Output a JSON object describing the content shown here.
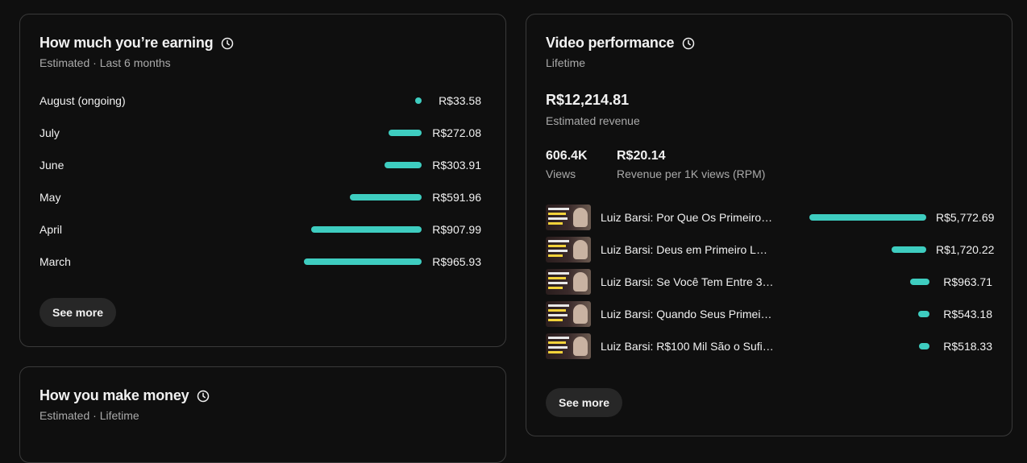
{
  "earning": {
    "title": "How much you’re earning",
    "subtitle": "Estimated · Last 6 months",
    "see_more": "See more",
    "months": [
      {
        "label": "August (ongoing)",
        "value": "R$33.58",
        "amount": 33.58
      },
      {
        "label": "July",
        "value": "R$272.08",
        "amount": 272.08
      },
      {
        "label": "June",
        "value": "R$303.91",
        "amount": 303.91
      },
      {
        "label": "May",
        "value": "R$591.96",
        "amount": 591.96
      },
      {
        "label": "April",
        "value": "R$907.99",
        "amount": 907.99
      },
      {
        "label": "March",
        "value": "R$965.93",
        "amount": 965.93
      }
    ]
  },
  "make_money": {
    "title": "How you make money",
    "subtitle": "Estimated · Lifetime"
  },
  "video_performance": {
    "title": "Video performance",
    "subtitle": "Lifetime",
    "revenue_value": "R$12,214.81",
    "revenue_label": "Estimated revenue",
    "views_value": "606.4K",
    "views_label": "Views",
    "rpm_value": "R$20.14",
    "rpm_label": "Revenue per 1K views (RPM)",
    "see_more": "See more",
    "videos": [
      {
        "title": "Luiz Barsi: Por Que Os Primeiros 1...",
        "value": "R$5,772.69",
        "amount": 5772.69
      },
      {
        "title": "Luiz Barsi: Deus em Primeiro Lugar...",
        "value": "R$1,720.22",
        "amount": 1720.22
      },
      {
        "title": "Luiz Barsi: Se Você Tem Entre 35 e...",
        "value": "R$963.71",
        "amount": 963.71
      },
      {
        "title": "Luiz Barsi: Quando Seus Primeiros ...",
        "value": "R$543.18",
        "amount": 543.18
      },
      {
        "title": "Luiz Barsi: R$100 Mil São o Suficie...",
        "value": "R$518.33",
        "amount": 518.33
      }
    ]
  },
  "colors": {
    "accent_bar": "#3ecdc0",
    "background": "#0f0f0f",
    "card_border": "#3a3a3a",
    "button_bg": "#272727"
  }
}
